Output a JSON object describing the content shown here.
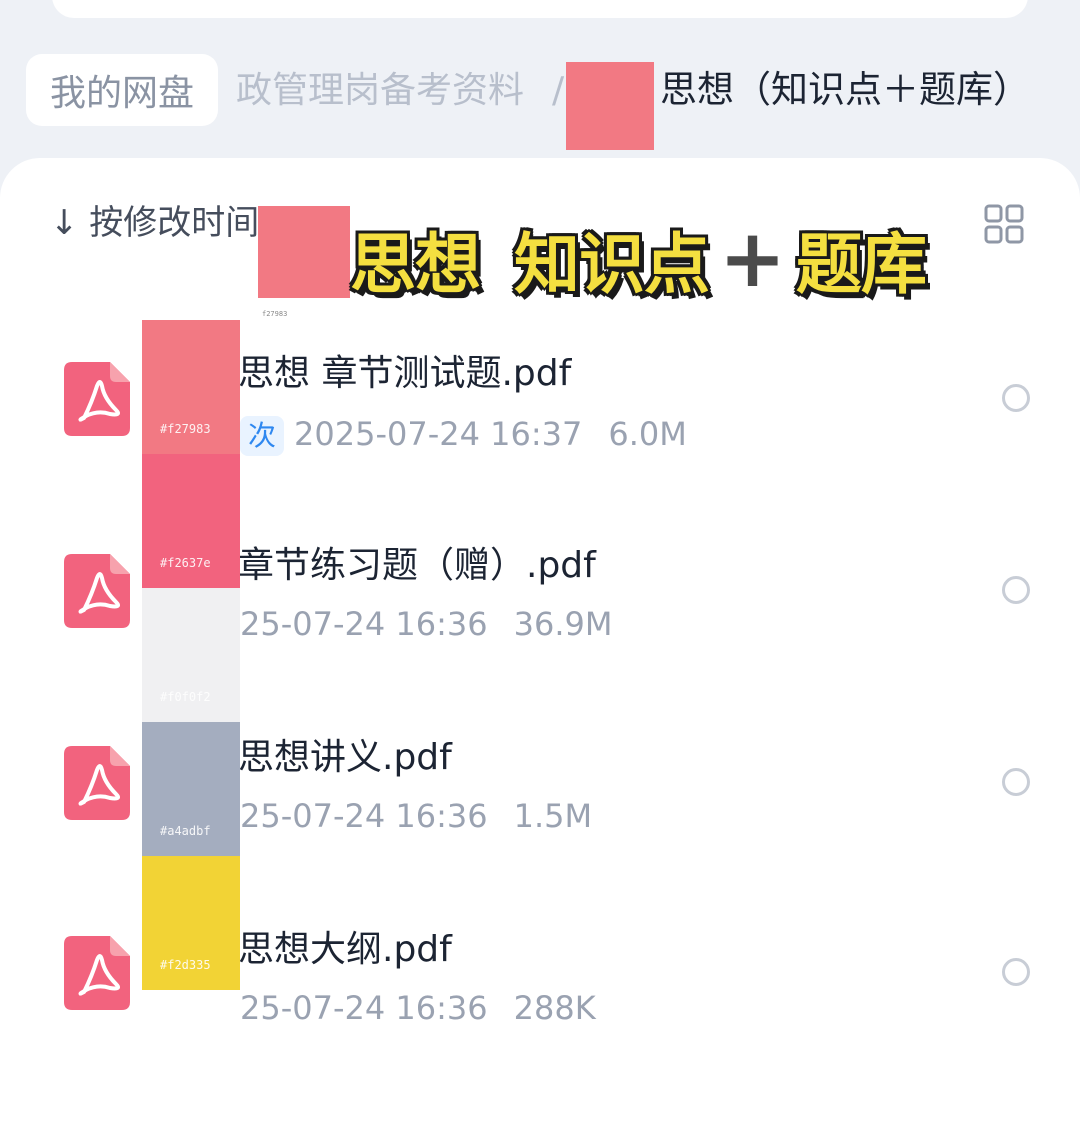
{
  "breadcrumb": {
    "home": "我的网盘",
    "parent_faded": "政管理岗备考资料",
    "separator": "/",
    "current": "思想（知识点＋题库）"
  },
  "toolbar": {
    "sort_label": "↓ 按修改时间",
    "view_toggle_icon": "grid-icon"
  },
  "banner": {
    "part1": "思想",
    "part2": "知识点",
    "plus": "+",
    "part3": "题库"
  },
  "swatch_labels": {
    "top": "f27983",
    "mid": "f27983"
  },
  "palette": [
    {
      "hex": "#f27983",
      "label": "#f27983"
    },
    {
      "hex": "#f2637e",
      "label": "#f2637e"
    },
    {
      "hex": "#f0f0f2",
      "label": "#f0f0f2"
    },
    {
      "hex": "#a4adbf",
      "label": "#a4adbf"
    },
    {
      "hex": "#f2d335",
      "label": "#f2d335"
    }
  ],
  "files": [
    {
      "name": "思想 章节测试题.pdf",
      "tag": "次",
      "date": "2025-07-24 16:37",
      "size": "6.0M"
    },
    {
      "name": "章节练习题（赠）.pdf",
      "tag": "",
      "date": "25-07-24 16:36",
      "size": "36.9M"
    },
    {
      "name": "思想讲义.pdf",
      "tag": "",
      "date": "25-07-24 16:36",
      "size": "1.5M"
    },
    {
      "name": "思想大纲.pdf",
      "tag": "",
      "date": "25-07-24 16:36",
      "size": "288K"
    }
  ],
  "colors": {
    "accent_pdf": "#f2637e",
    "background": "#eef1f6",
    "text_primary": "#1c2433",
    "text_secondary": "#9aa2b1"
  }
}
